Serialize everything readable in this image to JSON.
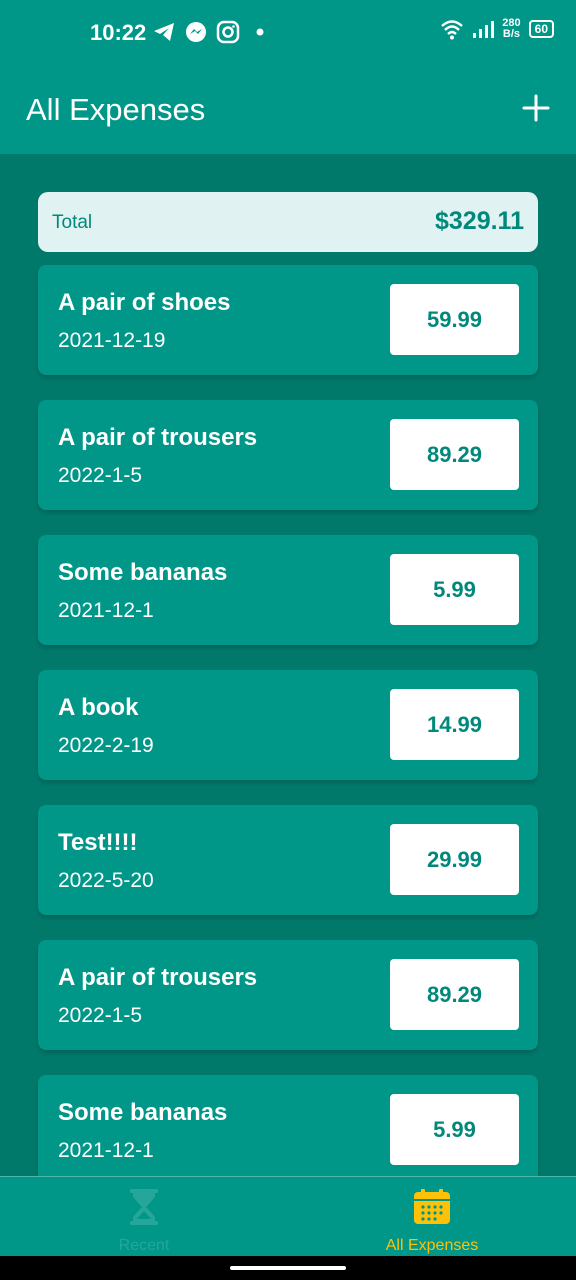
{
  "status_bar": {
    "time": "10:22",
    "net_speed_value": "280",
    "net_speed_unit": "B/s",
    "battery": "60"
  },
  "app_bar": {
    "title": "All Expenses",
    "add_icon": "plus-icon"
  },
  "total": {
    "label": "Total",
    "value": "$329.11"
  },
  "expenses": [
    {
      "title": "A pair of shoes",
      "date": "2021-12-19",
      "amount": "59.99"
    },
    {
      "title": "A pair of trousers",
      "date": "2022-1-5",
      "amount": "89.29"
    },
    {
      "title": "Some bananas",
      "date": "2021-12-1",
      "amount": "5.99"
    },
    {
      "title": "A book",
      "date": "2022-2-19",
      "amount": "14.99"
    },
    {
      "title": "Test!!!!",
      "date": "2022-5-20",
      "amount": "29.99"
    },
    {
      "title": "A pair of trousers",
      "date": "2022-1-5",
      "amount": "89.29"
    },
    {
      "title": "Some bananas",
      "date": "2021-12-1",
      "amount": "5.99"
    }
  ],
  "bottom_nav": {
    "items": [
      {
        "label": "Recent",
        "icon": "hourglass-icon",
        "active": false
      },
      {
        "label": "All Expenses",
        "icon": "calendar-icon",
        "active": true
      }
    ]
  },
  "colors": {
    "primary": "#009688",
    "background": "#00796b",
    "accent": "#ffc107",
    "total_bg": "#e0f2f1"
  }
}
